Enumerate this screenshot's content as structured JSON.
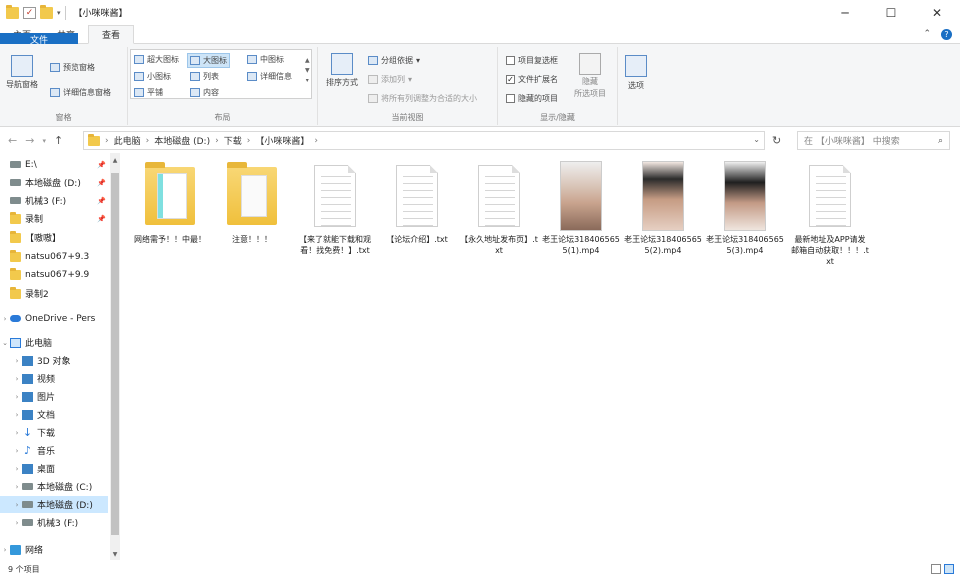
{
  "window": {
    "title": "【小咪咪酱】",
    "minimize": "─",
    "maximize": "☐",
    "close": "✕"
  },
  "tabs": [
    {
      "label": "文件"
    },
    {
      "label": "主页"
    },
    {
      "label": "共享"
    },
    {
      "label": "查看"
    }
  ],
  "ribbon": {
    "pane": {
      "nav_pane": "导航窗格",
      "preview_pane": "预览窗格",
      "details_pane": "详细信息窗格",
      "group_label": "窗格"
    },
    "layout": {
      "extra_large": "超大图标",
      "large": "大图标",
      "medium": "中图标",
      "small": "小图标",
      "list": "列表",
      "details": "详细信息",
      "tiles": "平铺",
      "content": "内容",
      "group_label": "布局"
    },
    "current_view": {
      "sort_by": "排序方式",
      "group_by": "分组依据",
      "add_columns": "添加列",
      "size_all_columns": "将所有列调整为合适的大小",
      "group_label": "当前视图"
    },
    "show_hide": {
      "item_checkboxes": "项目复选框",
      "file_extensions": "文件扩展名",
      "hidden_items": "隐藏的项目",
      "hide_selected": "隐藏",
      "hide_selected_2": "所选项目",
      "group_label": "显示/隐藏"
    },
    "options": "选项"
  },
  "address": {
    "crumbs": [
      "此电脑",
      "本地磁盘 (D:)",
      "下载",
      "【小咪咪酱】"
    ],
    "search_placeholder": "在 【小咪咪酱】 中搜索"
  },
  "nav": {
    "quick": [
      {
        "label": "E:\\"
      },
      {
        "label": "本地磁盘 (D:)"
      },
      {
        "label": "机械3 (F:)"
      },
      {
        "label": "录制"
      },
      {
        "label": "【嗷嗷】"
      },
      {
        "label": "natsu067+9.3"
      },
      {
        "label": "natsu067+9.9"
      },
      {
        "label": "录制2"
      }
    ],
    "onedrive": "OneDrive - Pers",
    "this_pc": "此电脑",
    "pc_items": [
      {
        "label": "3D 对象"
      },
      {
        "label": "视频"
      },
      {
        "label": "图片"
      },
      {
        "label": "文档"
      },
      {
        "label": "下载"
      },
      {
        "label": "音乐"
      },
      {
        "label": "桌面"
      },
      {
        "label": "本地磁盘 (C:)"
      },
      {
        "label": "本地磁盘 (D:)"
      },
      {
        "label": "机械3 (F:)"
      }
    ],
    "network": "网络"
  },
  "files": [
    {
      "label": "网络需予！！中最！",
      "kind": "folder"
    },
    {
      "label": "注意！！！",
      "kind": "folder"
    },
    {
      "label": "【来了就能下载和观看！找免费！】.txt",
      "kind": "txt"
    },
    {
      "label": "【论坛介绍】.txt",
      "kind": "txt"
    },
    {
      "label": "【永久地址发布页】.txt",
      "kind": "txt"
    },
    {
      "label": "老王论坛3184065655(1).mp4",
      "kind": "video"
    },
    {
      "label": "老王论坛3184065655(2).mp4",
      "kind": "video"
    },
    {
      "label": "老王论坛3184065655(3).mp4",
      "kind": "video"
    },
    {
      "label": "最新地址及APP请发邮箱自动获取！！！.txt",
      "kind": "txt"
    }
  ],
  "status": {
    "count": "9 个项目"
  }
}
